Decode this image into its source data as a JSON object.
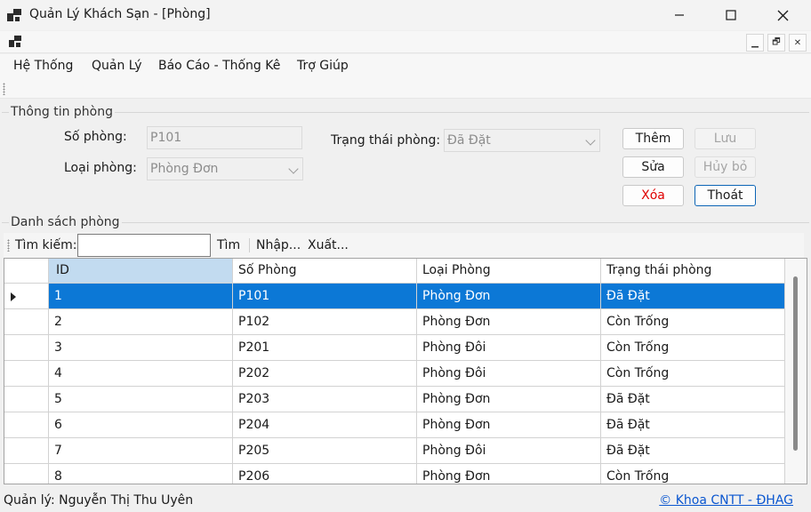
{
  "window": {
    "title": "Quản Lý Khách Sạn - [Phòng]"
  },
  "mdi": {
    "minimize": "▁",
    "restore": "🗗",
    "close": "✕"
  },
  "menu": {
    "items": [
      "Hệ Thống",
      "Quản Lý",
      "Báo Cáo - Thống Kê",
      "Trợ Giúp"
    ]
  },
  "info": {
    "legend": "Thông tin phòng",
    "so_phong_label": "Số phòng:",
    "so_phong_value": "P101",
    "loai_phong_label": "Loại phòng:",
    "loai_phong_value": "Phòng Đơn",
    "trang_thai_label": "Trạng thái phòng:",
    "trang_thai_value": "Đã Đặt"
  },
  "buttons": {
    "them": "Thêm",
    "luu": "Lưu",
    "sua": "Sửa",
    "huy": "Hủy bỏ",
    "xoa": "Xóa",
    "thoat": "Thoát"
  },
  "list": {
    "legend": "Danh sách phòng",
    "search_label": "Tìm kiếm:",
    "search_value": "",
    "find": "Tìm",
    "import": "Nhập...",
    "export": "Xuất..."
  },
  "table": {
    "columns": [
      "ID",
      "Số Phòng",
      "Loại Phòng",
      "Trạng thái phòng"
    ],
    "rows": [
      [
        "1",
        "P101",
        "Phòng Đơn",
        "Đã Đặt"
      ],
      [
        "2",
        "P102",
        "Phòng Đơn",
        "Còn Trống"
      ],
      [
        "3",
        "P201",
        "Phòng Đôi",
        "Còn Trống"
      ],
      [
        "4",
        "P202",
        "Phòng Đôi",
        "Còn Trống"
      ],
      [
        "5",
        "P203",
        "Phòng Đơn",
        "Đã Đặt"
      ],
      [
        "6",
        "P204",
        "Phòng Đơn",
        "Đã Đặt"
      ],
      [
        "7",
        "P205",
        "Phòng Đôi",
        "Đã Đặt"
      ],
      [
        "8",
        "P206",
        "Phòng Đơn",
        "Còn Trống"
      ]
    ],
    "selected_row": 0
  },
  "status": {
    "manager": "Quản lý: Nguyễn Thị Thu Uyên",
    "credit": "© Khoa CNTT - ĐHAG"
  }
}
